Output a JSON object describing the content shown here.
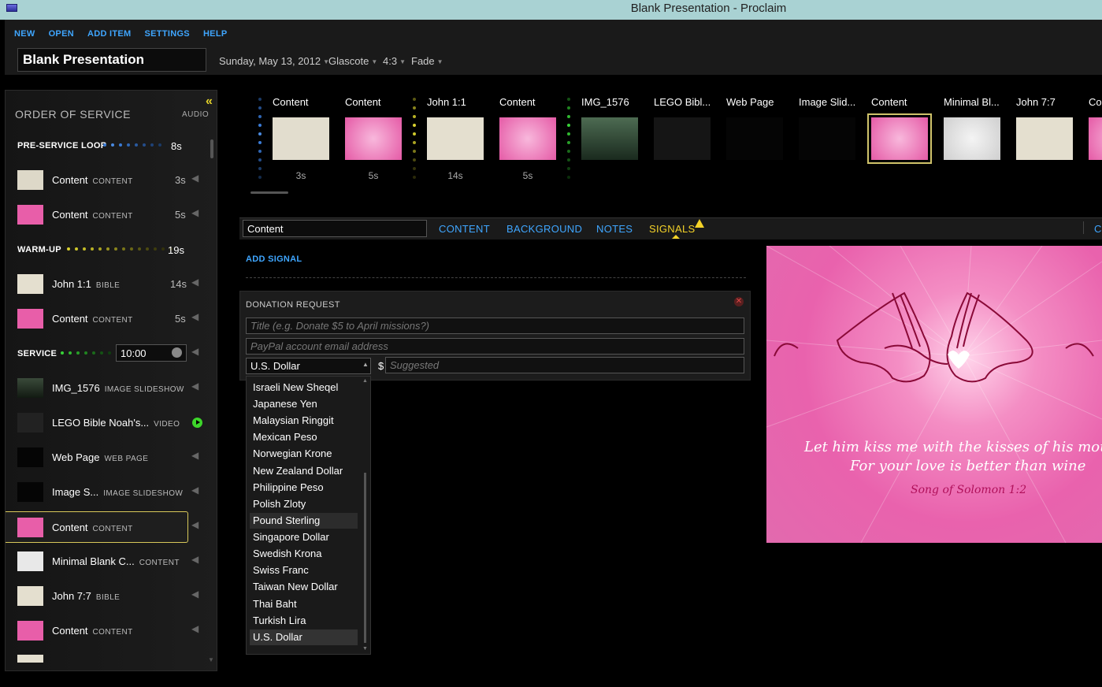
{
  "window": {
    "title": "Blank Presentation - Proclaim"
  },
  "menu": [
    "NEW",
    "OPEN",
    "ADD ITEM",
    "SETTINGS",
    "HELP"
  ],
  "presentation": {
    "title": "Blank Presentation",
    "date": "Sunday, May 13, 2012",
    "theme": "Glascote",
    "aspect": "4:3",
    "transition": "Fade"
  },
  "order_of_service": {
    "title": "ORDER OF SERVICE",
    "audio_label": "AUDIO",
    "pre_service": {
      "label": "PRE-SERVICE LOOP",
      "duration": "8s"
    },
    "warm_up": {
      "label": "WARM-UP",
      "duration": "19s"
    },
    "service": {
      "label": "SERVICE",
      "time": "10:00"
    },
    "items": [
      {
        "name": "Content",
        "type": "CONTENT",
        "duration": "3s"
      },
      {
        "name": "Content",
        "type": "CONTENT",
        "duration": "5s"
      },
      {
        "name": "John 1:1",
        "type": "BIBLE",
        "duration": "14s"
      },
      {
        "name": "Content",
        "type": "CONTENT",
        "duration": "5s"
      },
      {
        "name": "IMG_1576",
        "type": "IMAGE SLIDESHOW",
        "duration": ""
      },
      {
        "name": "LEGO Bible  Noah's...",
        "type": "VIDEO",
        "duration": ""
      },
      {
        "name": "Web Page",
        "type": "WEB PAGE",
        "duration": ""
      },
      {
        "name": "Image S...",
        "type": "IMAGE SLIDESHOW",
        "duration": ""
      },
      {
        "name": "Content",
        "type": "CONTENT",
        "duration": ""
      },
      {
        "name": "Minimal Blank C...",
        "type": "CONTENT",
        "duration": ""
      },
      {
        "name": "John 7:7",
        "type": "BIBLE",
        "duration": ""
      },
      {
        "name": "Content",
        "type": "CONTENT",
        "duration": ""
      }
    ]
  },
  "strip": [
    {
      "title": "Content",
      "duration": "3s"
    },
    {
      "title": "Content",
      "duration": "5s"
    },
    {
      "title": "John 1:1",
      "duration": "14s"
    },
    {
      "title": "Content",
      "duration": "5s"
    },
    {
      "title": "IMG_1576",
      "duration": ""
    },
    {
      "title": "LEGO Bibl...",
      "duration": ""
    },
    {
      "title": "Web Page",
      "duration": ""
    },
    {
      "title": "Image Slid...",
      "duration": ""
    },
    {
      "title": "Content",
      "duration": ""
    },
    {
      "title": "Minimal Bl...",
      "duration": ""
    },
    {
      "title": "John 7:7",
      "duration": ""
    },
    {
      "title": "Co",
      "duration": ""
    }
  ],
  "editor": {
    "slide_name": "Content",
    "tabs": [
      "CONTENT",
      "BACKGROUND",
      "NOTES",
      "SIGNALS"
    ],
    "tab_right": "C",
    "add_signal": "ADD SIGNAL"
  },
  "donation": {
    "title": "DONATION REQUEST",
    "title_placeholder": "Title (e.g. Donate $5 to April missions?)",
    "email_placeholder": "PayPal account email address",
    "currency": "U.S. Dollar",
    "dollar_sign": "$",
    "amount_placeholder": "Suggested"
  },
  "currency_options": [
    "Israeli New Sheqel",
    "Japanese Yen",
    "Malaysian Ringgit",
    "Mexican Peso",
    "Norwegian Krone",
    "New Zealand Dollar",
    "Philippine Peso",
    "Polish Zloty",
    "Pound Sterling",
    "Singapore Dollar",
    "Swedish Krona",
    "Swiss Franc",
    "Taiwan New Dollar",
    "Thai Baht",
    "Turkish Lira",
    "U.S. Dollar"
  ],
  "preview": {
    "line1": "Let him kiss me with the kisses of his mou",
    "line2": "For your love is better than wine",
    "reference": "Song of Solomon 1:2"
  },
  "colors": {
    "accent": "#3fa6ff",
    "active_tab": "#f4d228",
    "selection": "#d8c85a",
    "pink": "#e962ad"
  }
}
